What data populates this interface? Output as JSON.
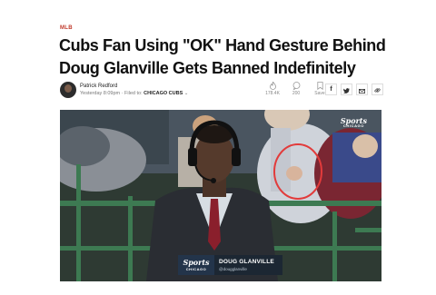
{
  "article": {
    "section_tag": "MLB",
    "headline": "Cubs Fan Using \"OK\" Hand Gesture Behind Doug Glanville Gets Banned Indefinitely"
  },
  "byline": {
    "author": "Patrick Redford",
    "timestamp": "Yesterday 8:09pm",
    "filed_label": "Filed to:",
    "filed_category": "CHICAGO CUBS",
    "filed_chevron": "⌄"
  },
  "stats": {
    "views": {
      "icon": "flame-icon",
      "glyph": "🔥",
      "count": "178.4K"
    },
    "comments": {
      "icon": "comment-icon",
      "glyph": "💬",
      "count": "200"
    },
    "save": {
      "icon": "bookmark-icon",
      "glyph": "🔖",
      "label": "Save"
    }
  },
  "share": [
    {
      "name": "facebook-share",
      "glyph": "f"
    },
    {
      "name": "twitter-share",
      "glyph": "🐦"
    },
    {
      "name": "email-share",
      "glyph": "✉"
    },
    {
      "name": "link-share",
      "glyph": "🔗"
    }
  ],
  "photo": {
    "corner_bug": {
      "main": "Sports",
      "sub": "CHICAGO"
    },
    "lower_third": {
      "logo_main": "Sports",
      "logo_sub": "CHICAGO",
      "name": "DOUG GLANVILLE",
      "handle": "@dougglanville"
    },
    "highlight_color": "#e23b3b"
  }
}
